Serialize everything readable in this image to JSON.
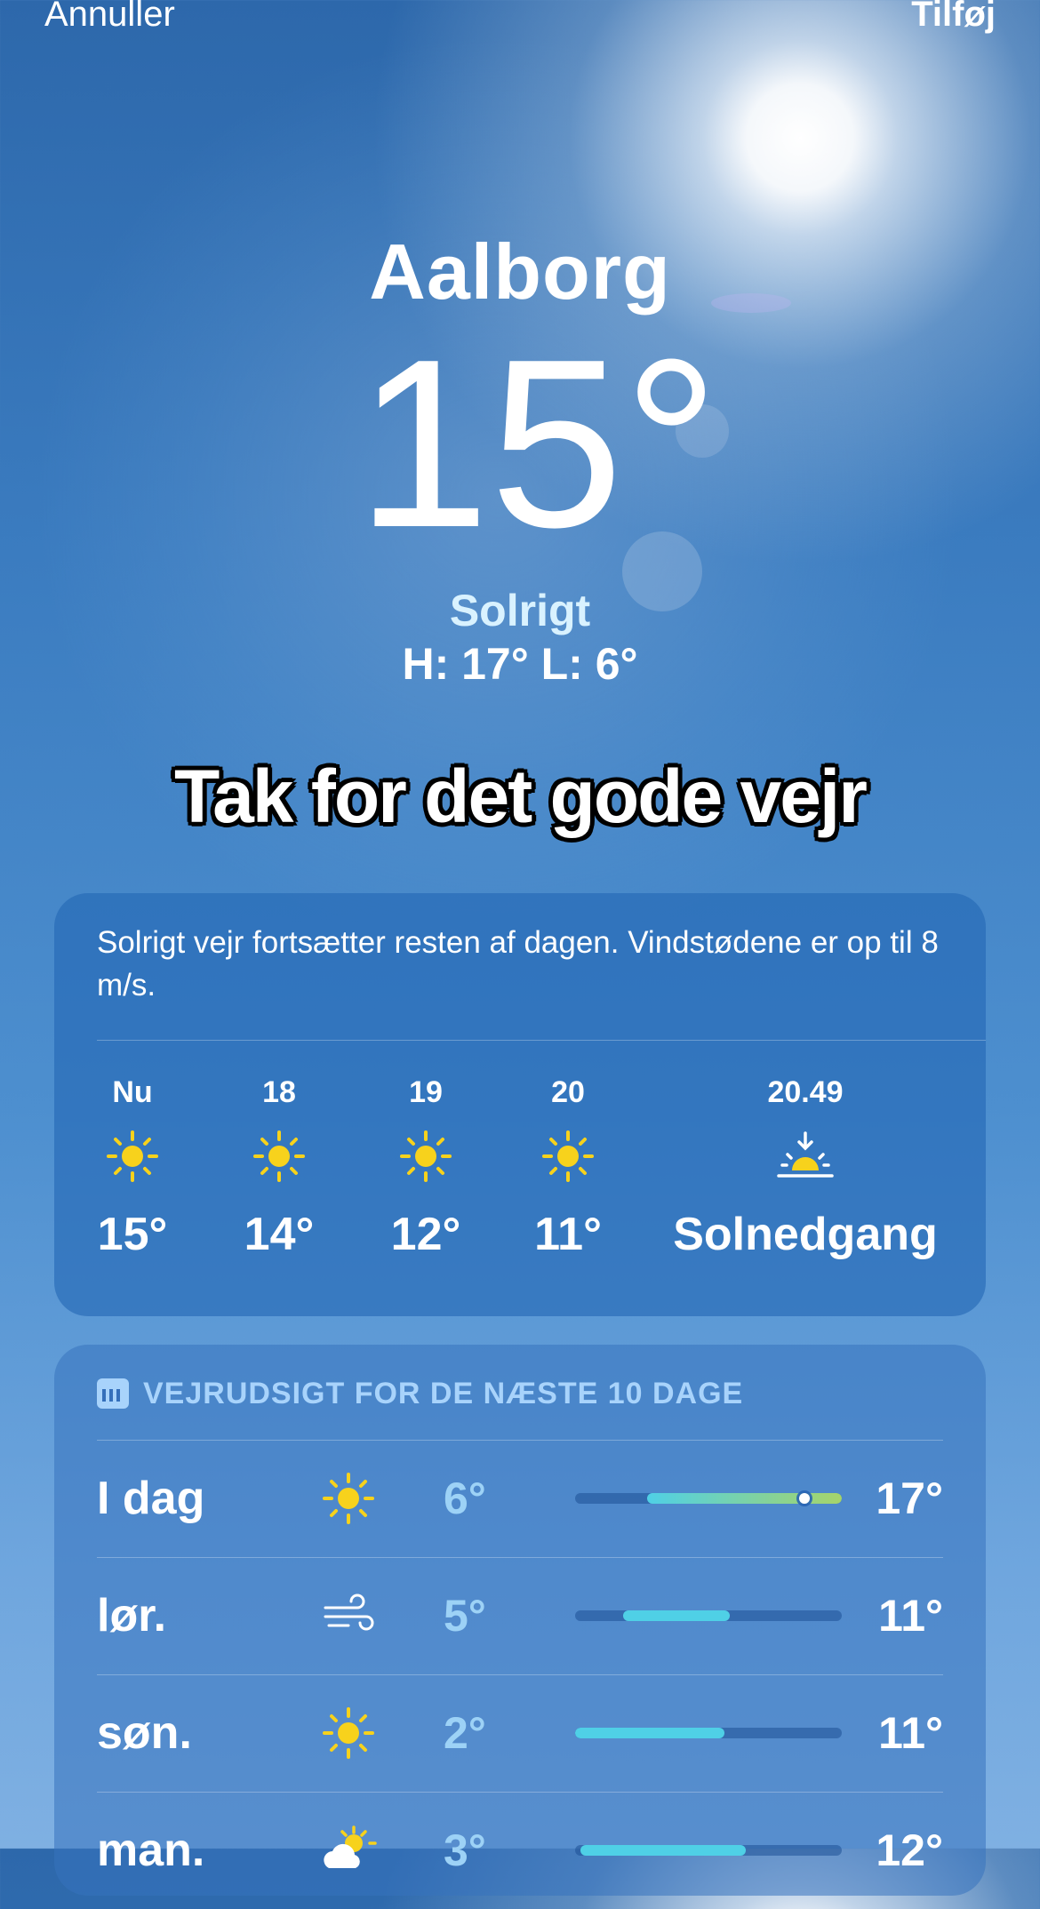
{
  "nav": {
    "cancel_label": "Annuller",
    "add_label": "Tilføj"
  },
  "location": {
    "city": "Aalborg",
    "temperature": "15°",
    "condition": "Solrigt",
    "high_low": "H: 17°  L: 6°"
  },
  "caption": "Tak for det gode vejr",
  "hourly": {
    "summary": "Solrigt vejr fortsætter resten af dagen. Vindstødene er op til 8 m/s.",
    "items": [
      {
        "time": "Nu",
        "icon": "sun-icon",
        "value": "15°"
      },
      {
        "time": "18",
        "icon": "sun-icon",
        "value": "14°"
      },
      {
        "time": "19",
        "icon": "sun-icon",
        "value": "12°"
      },
      {
        "time": "20",
        "icon": "sun-icon",
        "value": "11°"
      },
      {
        "time": "20.49",
        "icon": "sunset-icon",
        "value": "Solnedgang"
      }
    ]
  },
  "daily": {
    "header": "VEJRUDSIGT FOR DE NÆSTE 10 DAGE",
    "days": [
      {
        "name": "I dag",
        "icon": "sun-icon",
        "low": "6°",
        "high": "17°",
        "range_start": 0.27,
        "range_end": 1.0,
        "current": 0.86
      },
      {
        "name": "lør.",
        "icon": "wind-icon",
        "low": "5°",
        "high": "11°",
        "range_start": 0.18,
        "range_end": 0.58
      },
      {
        "name": "søn.",
        "icon": "sun-icon",
        "low": "2°",
        "high": "11°",
        "range_start": 0.0,
        "range_end": 0.56
      },
      {
        "name": "man.",
        "icon": "partly-cloudy-icon",
        "low": "3°",
        "high": "12°",
        "range_start": 0.02,
        "range_end": 0.64
      }
    ]
  },
  "colors": {
    "sun": "#f7d21c",
    "bar_cool": "#4fd0e6",
    "bar_warm": "#a6d46a"
  }
}
